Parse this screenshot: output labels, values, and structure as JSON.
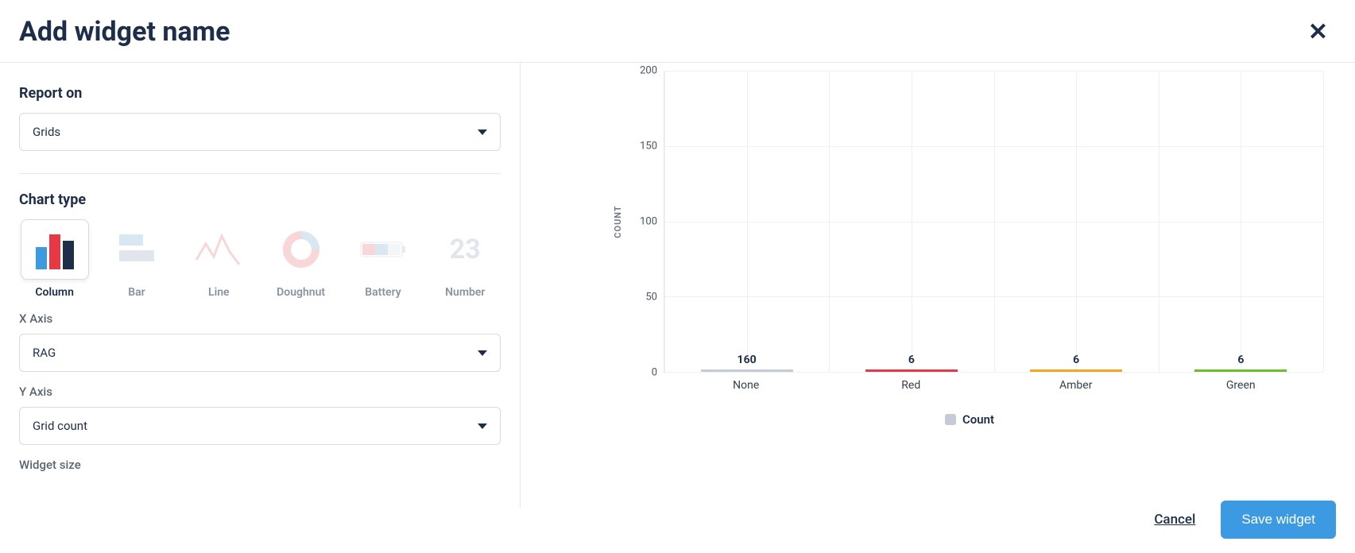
{
  "header": {
    "title": "Add widget name"
  },
  "form": {
    "report_on": {
      "label": "Report on",
      "value": "Grids"
    },
    "chart_type": {
      "label": "Chart type",
      "options": [
        "Column",
        "Bar",
        "Line",
        "Doughnut",
        "Battery",
        "Number"
      ],
      "selected": "Column",
      "number_tile_text": "23"
    },
    "x_axis": {
      "label": "X Axis",
      "value": "RAG"
    },
    "y_axis": {
      "label": "Y Axis",
      "value": "Grid count"
    },
    "widget_size": {
      "label": "Widget size"
    }
  },
  "footer": {
    "cancel": "Cancel",
    "save": "Save widget"
  },
  "chart_data": {
    "type": "bar",
    "categories": [
      "None",
      "Red",
      "Amber",
      "Green"
    ],
    "values": [
      160,
      6,
      6,
      6
    ],
    "colors": [
      "#c4cbd4",
      "#e63946",
      "#f5a623",
      "#6bbf2a"
    ],
    "ylabel": "COUNT",
    "ylim": [
      0,
      200
    ],
    "yticks": [
      0,
      50,
      100,
      150,
      200
    ],
    "legend": "Count"
  }
}
